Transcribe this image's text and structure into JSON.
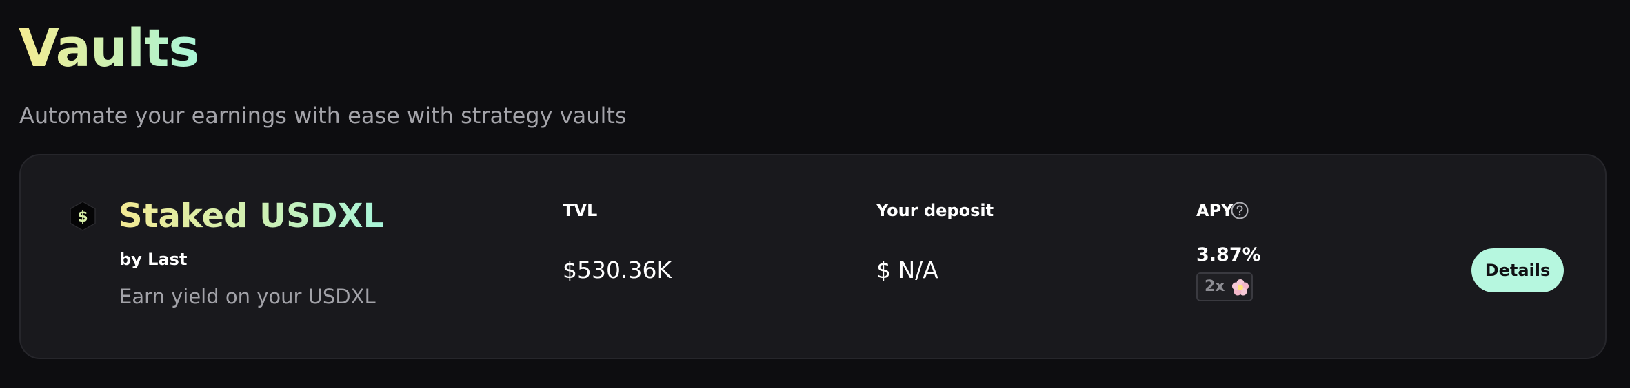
{
  "page": {
    "title": "Vaults",
    "subtitle": "Automate your earnings with ease with strategy vaults"
  },
  "vault": {
    "icon": "dollar-hexagon-icon",
    "name": "Staked USDXL",
    "by": "by Last",
    "description": "Earn yield on your USDXL",
    "tvl_label": "TVL",
    "tvl_value": "$530.36K",
    "deposit_label": "Your deposit",
    "deposit_value": "$ N/A",
    "apy_label": "APY",
    "apy_help_icon": "question-circle-icon",
    "apy_value": "3.87%",
    "boost_multiplier": "2x",
    "boost_icon": "flower-icon",
    "details_label": "Details"
  },
  "colors": {
    "background": "#0d0d10",
    "card": "#19191d",
    "accent_mint": "#b6f7df",
    "title_gradient_start": "#f5ec92",
    "title_gradient_end": "#a9f5d8"
  }
}
